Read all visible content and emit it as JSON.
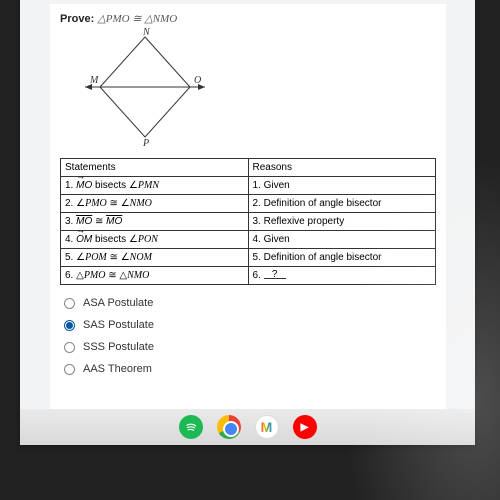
{
  "prove_label": "Prove:",
  "prove_expr": "△PMO ≅ △NMO",
  "labels": {
    "N": "N",
    "M": "M",
    "O": "O",
    "P": "P"
  },
  "headers": {
    "statements": "Statements",
    "reasons": "Reasons"
  },
  "rows": [
    {
      "n": "1.",
      "stmt_html": "<span class='ray'>MO</span> bisects ∠<span class='math'>PMN</span>",
      "reason": "1. Given"
    },
    {
      "n": "2.",
      "stmt_html": "∠<span class='math'>PMO</span> ≅ ∠<span class='math'>NMO</span>",
      "reason": "2. Definition of angle bisector"
    },
    {
      "n": "3.",
      "stmt_html": "<span class='seg'>MO</span> ≅ <span class='seg'>MO</span>",
      "reason": "3. Reflexive property"
    },
    {
      "n": "4.",
      "stmt_html": "<span class='ray'>OM</span> bisects ∠<span class='math'>PON</span>",
      "reason": "4. Given"
    },
    {
      "n": "5.",
      "stmt_html": "∠<span class='math'>POM</span> ≅ ∠<span class='math'>NOM</span>",
      "reason": "5. Definition of angle bisector"
    },
    {
      "n": "6.",
      "stmt_html": "△<span class='math'>PMO</span> ≅ △<span class='math'>NMO</span>",
      "reason_html": "6. <span class='dashfill'><span>?</span></span>"
    }
  ],
  "options": [
    {
      "label": "ASA Postulate",
      "selected": false
    },
    {
      "label": "SAS Postulate",
      "selected": true
    },
    {
      "label": "SSS Postulate",
      "selected": false
    },
    {
      "label": "AAS Theorem",
      "selected": false
    }
  ]
}
